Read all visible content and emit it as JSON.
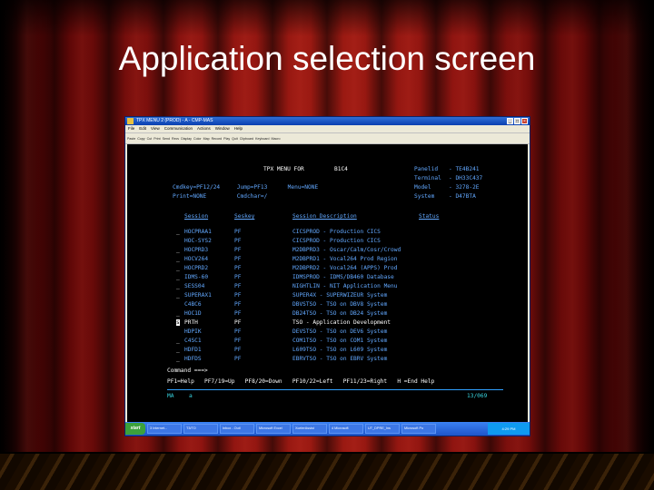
{
  "slide": {
    "title": "Application selection screen"
  },
  "window": {
    "title": "TPX MENU 2 (PROD) - A - CMP-MAS",
    "menu": [
      "File",
      "Edit",
      "View",
      "Communication",
      "Actions",
      "Window",
      "Help"
    ],
    "toolbar": [
      "Paste",
      "Copy",
      "Cut",
      "Print",
      "Send",
      "Recv",
      "Display",
      "Color",
      "Map",
      "Record",
      "Play",
      "Quit",
      "Clipboard",
      "Keyboard",
      "Macro"
    ]
  },
  "terminal": {
    "menu_title": "TPX MENU FOR",
    "user_id": "B1C4",
    "panel_id_label": "Panelid",
    "panel_id": "- TE4B241",
    "terminal_label": "Terminal",
    "terminal": "- DH33C437",
    "model_label": "Model",
    "model": "- 3278-2E",
    "system_label": "System",
    "system": "- D47BTA",
    "cmdkey_line": "Cmdkey=PF12/24     Jump=PF13      Menu=NONE",
    "print_line": "Print=NONE         Cmdchar=/",
    "headers": {
      "session": "Session",
      "seskey": "Seskey",
      "description": "Session Description",
      "status": "Status"
    },
    "sessions": [
      {
        "mark": "_",
        "session": "HOCPRAA1",
        "seskey": "PF",
        "description": "CICSPROD - Production CICS"
      },
      {
        "mark": "",
        "session": "HOC-SYS2",
        "seskey": "PF",
        "description": "CICSPROD - Production CICS"
      },
      {
        "mark": "_",
        "session": "HOCPRD3",
        "seskey": "PF",
        "description": "M2DBPRD3 - Oscar/Calm/Cosr/Crowd"
      },
      {
        "mark": "_",
        "session": "HOCV264",
        "seskey": "PF",
        "description": "M2DBPRD1 - Vocal264 Prod Region"
      },
      {
        "mark": "_",
        "session": "HOCPRD2",
        "seskey": "PF",
        "description": "M2DBPRD2 - Vocal264 (APPS) Prod"
      },
      {
        "mark": "_",
        "session": "IDMS-60",
        "seskey": "PF",
        "description": "IDMSPROD - IDMS/DB460 Database"
      },
      {
        "mark": "_",
        "session": "SESS04",
        "seskey": "PF",
        "description": "NIGHTLIN - NIT Application Menu"
      },
      {
        "mark": "_",
        "session": "SUPERAX1",
        "seskey": "PF",
        "description": "SUPER4X - SUPERWIZEUR System"
      },
      {
        "mark": "",
        "session": "C4BC6",
        "seskey": "PF",
        "description": "DBVSTSO - TSO on DBV8 System"
      },
      {
        "mark": "_",
        "session": "HOC1D",
        "seskey": "PF",
        "description": "DB24TSO - TSO on DB24 System"
      },
      {
        "mark": "s",
        "session": "PRTH",
        "seskey": "PF",
        "description": "TSO - Application Development"
      },
      {
        "mark": "",
        "session": "HDPIK",
        "seskey": "PF",
        "description": "DEVSTSO - TSO on DEV6 System"
      },
      {
        "mark": "_",
        "session": "C4SC1",
        "seskey": "PF",
        "description": "COM1TSO - TSO on COM1 System"
      },
      {
        "mark": "_",
        "session": "HDFD1",
        "seskey": "PF",
        "description": "L609TSO - TSO on L609 System"
      },
      {
        "mark": "_",
        "session": "HDFDS",
        "seskey": "PF",
        "description": "EBRVTSO - TSO on EBRV System"
      }
    ],
    "command_label": "Command ===>",
    "pf_keys": "PF1=Help   PF7/19=Up   PF8/20=Down   PF10/22=Left   PF11/23=Right   H =End Help",
    "oia_left": "MA",
    "oia_mid": "a",
    "oia_right": "13/069"
  },
  "taskbar": {
    "start": "start",
    "tasks": [
      "3 Internet...",
      "T3/TO",
      "Inbox - Outl",
      "Microsoft Excel",
      "XcelerAssist",
      "4 Microsoft",
      "UT_DPRE_Ins",
      "Microsoft Po"
    ],
    "clock": "4:29 PM"
  }
}
